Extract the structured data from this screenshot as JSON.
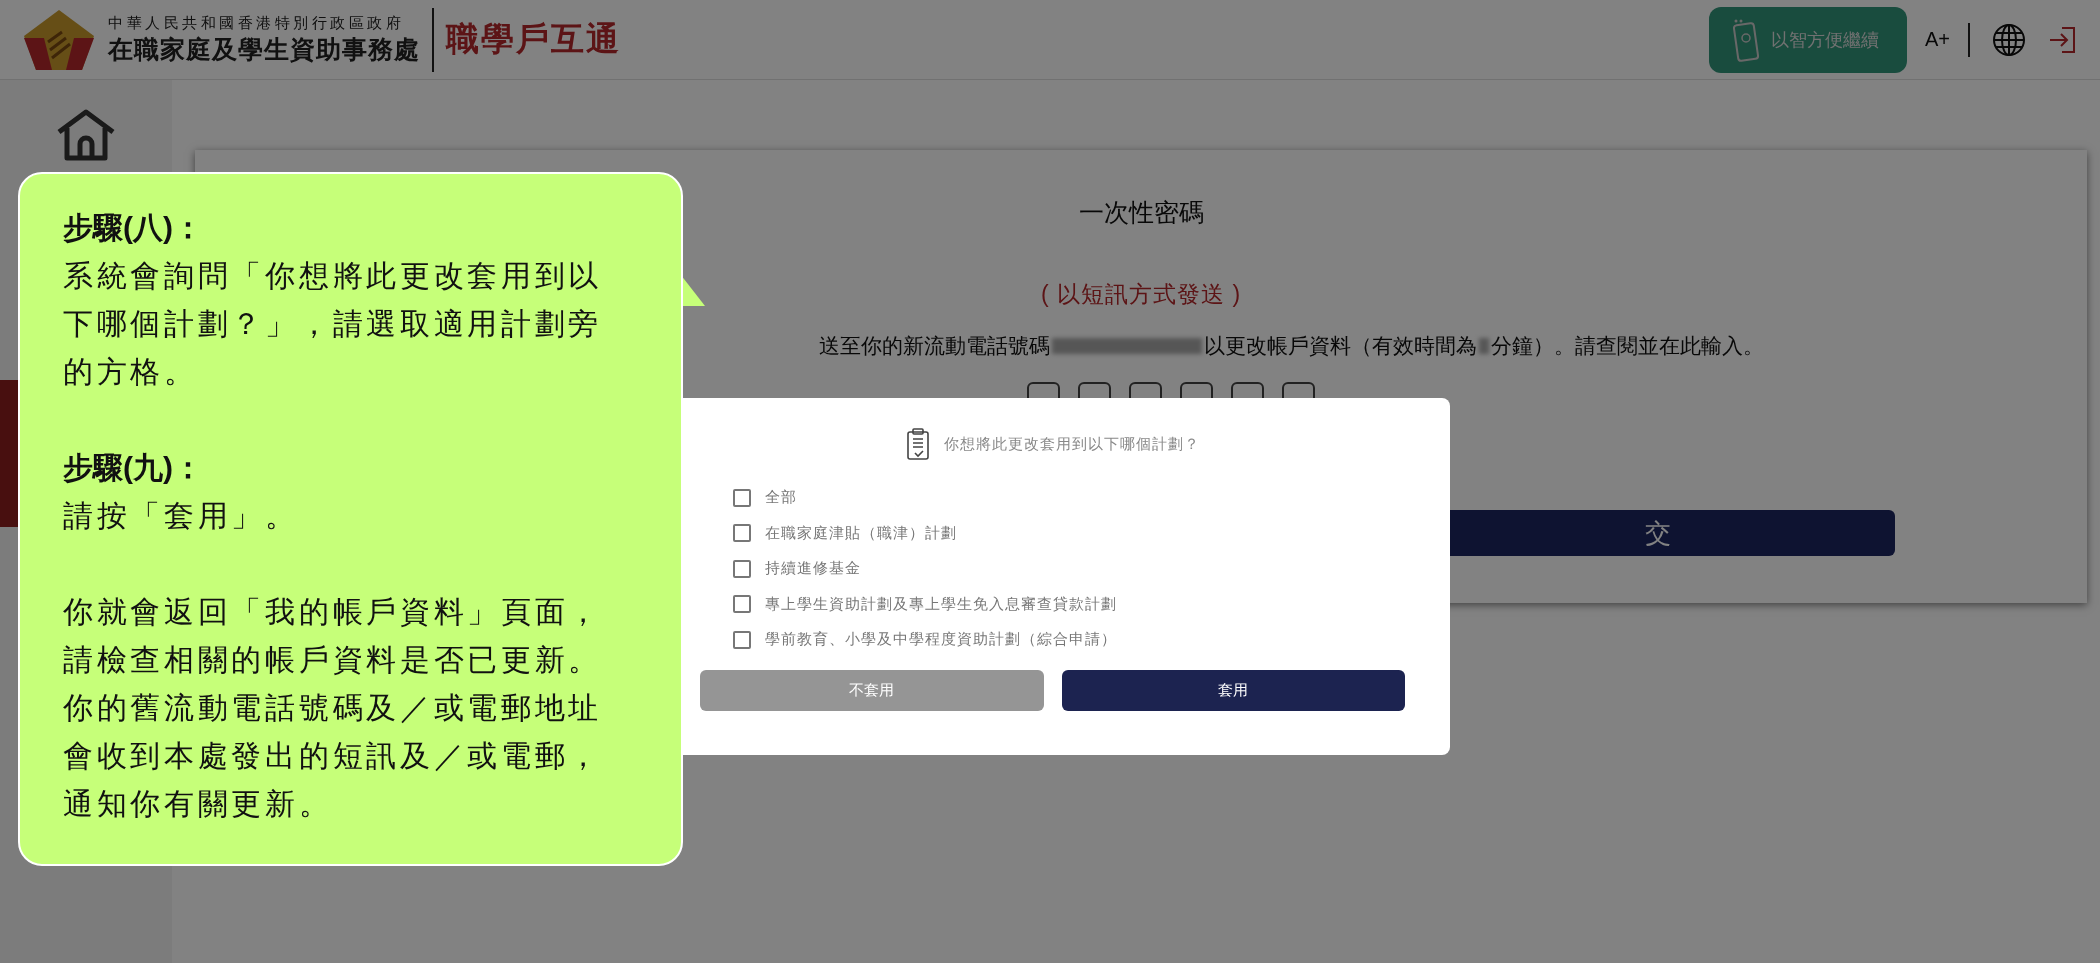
{
  "header": {
    "gov_name": "中華人民共和國香港特別行政區政府",
    "dept_name": "在職家庭及學生資助事務處",
    "app_name": "職學戶互通",
    "smart_button": "以智方便繼續",
    "font_button": "A+"
  },
  "otp_card": {
    "title": "一次性密碼",
    "delivery_note": "( 以短訊方式發送 )",
    "instruction_parts": [
      "送至你的新流動電話號碼",
      "以更改帳戶資料（有效時間為",
      "分鐘）。請查閱並在此輸入。"
    ],
    "submit_label": "交"
  },
  "dialog": {
    "question": "你想將此更改套用到以下哪個計劃？",
    "options": [
      {
        "label": "全部",
        "checked": false
      },
      {
        "label": "在職家庭津貼（職津）計劃",
        "checked": false
      },
      {
        "label": "持續進修基金",
        "checked": false
      },
      {
        "label": "專上學生資助計劃及專上學生免入息審查貸款計劃",
        "checked": false
      },
      {
        "label": "學前教育、小學及中學程度資助計劃（綜合申請）",
        "checked": false
      }
    ],
    "buttons": [
      {
        "label": "不套用",
        "kind": "secondary"
      },
      {
        "label": "套用",
        "kind": "primary"
      }
    ]
  },
  "callout": {
    "sections": [
      {
        "heading": "步驟(八)：",
        "paragraphs": [
          "系統會詢問「你想將此更改套用到以下哪個計劃？」，請選取適用計劃旁的方格。"
        ]
      },
      {
        "heading": "步驟(九)：",
        "paragraphs": [
          "請按「套用」。",
          "你就會返回「我的帳戶資料」頁面，請檢查相關的帳戶資料是否已更新。你的舊流動電話號碼及／或電郵地址會收到本處發出的短訊及／或電郵，通知你有關更新。"
        ]
      }
    ]
  }
}
